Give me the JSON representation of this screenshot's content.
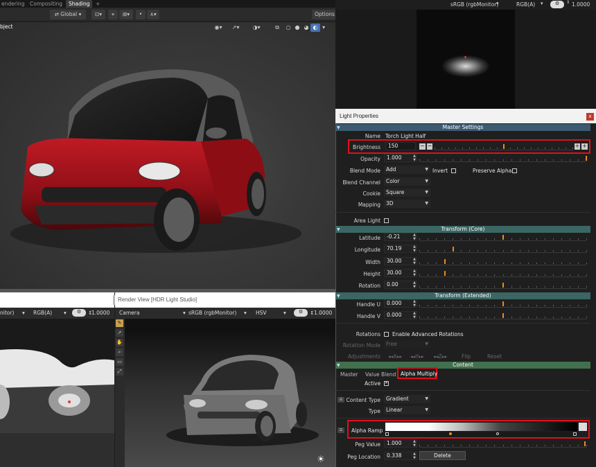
{
  "blender": {
    "tabs": [
      "endering",
      "Compositing",
      "Shading"
    ],
    "active_tab": "Shading",
    "add_tab": "+",
    "transform_orientation": "Global",
    "options_label": "Options",
    "object_label": "bject"
  },
  "image_view": {
    "color_space": "sRGB (rgbMonitor)",
    "channels": "RGB(A)",
    "exposure": "1.0000"
  },
  "light_properties": {
    "title": "Light Properties",
    "close": "x",
    "sections": {
      "master": "Master Settings",
      "transform_core": "Transform (Core)",
      "transform_extended": "Transform (Extended)",
      "content": "Content"
    },
    "name_label": "Name",
    "name_value": "Torch Light Half",
    "brightness_label": "Brightness",
    "brightness_value": "150",
    "opacity_label": "Opacity",
    "opacity_value": "1.000",
    "blend_mode_label": "Blend Mode",
    "blend_mode_value": "Add",
    "invert_label": "Invert",
    "invert_checked": false,
    "preserve_alpha_label": "Preserve Alpha",
    "preserve_alpha_checked": false,
    "blend_channel_label": "Blend Channel",
    "blend_channel_value": "Color",
    "cookie_label": "Cookie",
    "cookie_value": "Square",
    "mapping_label": "Mapping",
    "mapping_value": "3D",
    "area_light_label": "Area Light",
    "area_light_checked": false,
    "latitude_label": "Latitude",
    "latitude_value": "-0.21",
    "longitude_label": "Longitude",
    "longitude_value": "70.19",
    "width_label": "Width",
    "width_value": "30.00",
    "height_label": "Height",
    "height_value": "30.00",
    "rotation_label": "Rotation",
    "rotation_value": "0.00",
    "handle_u_label": "Handle U",
    "handle_u_value": "0.000",
    "handle_v_label": "Handle V",
    "handle_v_value": "0.000",
    "rotations_label": "Rotations",
    "enable_adv_rot_label": "Enable Advanced Rotations",
    "enable_adv_rot_checked": false,
    "rotation_mode_label": "Rotation Mode",
    "rotation_mode_value": "Free",
    "adjustments_label": "Adjustments",
    "adj_x": "X",
    "adj_y": "Y",
    "adj_z": "Z",
    "flip_label": "Flip",
    "reset_label": "Reset",
    "content_tabs": [
      "Master",
      "Value Blend",
      "Alpha Multiply"
    ],
    "active_content_tab": "Alpha Multiply",
    "active_label": "Active",
    "active_checked": true,
    "content_type_label": "Content Type",
    "content_type_value": "Gradient",
    "type_label": "Type",
    "type_value": "Linear",
    "alpha_ramp_label": "Alpha Ramp",
    "peg_value_label": "Peg Value",
    "peg_value_value": "1.000",
    "peg_location_label": "Peg Location",
    "peg_location_value": "0.338",
    "delete_label": "Delete",
    "slider_levels": {
      "brightness": 0.5,
      "opacity": 1.0,
      "latitude": 0.5,
      "longitude": 0.2,
      "width": 0.15,
      "height": 0.15,
      "rotation": 0.5,
      "handle_u": 0.5,
      "handle_v": 0.5,
      "peg_value": 0.99
    }
  },
  "bottom_left": {
    "color_space": "nitor)",
    "channels": "RGB(A)",
    "exposure": "1.0000"
  },
  "render_view": {
    "title": "Render View [HDR Light Studio]",
    "camera": "Camera",
    "color_space": "sRGB (rgbMonitor)",
    "color_model": "HSV",
    "exposure": "1.0000"
  },
  "colors": {
    "highlight_red": "#e0101a",
    "slider_orange": "#f08a1e",
    "master_section": "#3d5a71",
    "transform_section": "#3b6663",
    "content_section": "#42704d",
    "car_red": "#a8121c"
  }
}
